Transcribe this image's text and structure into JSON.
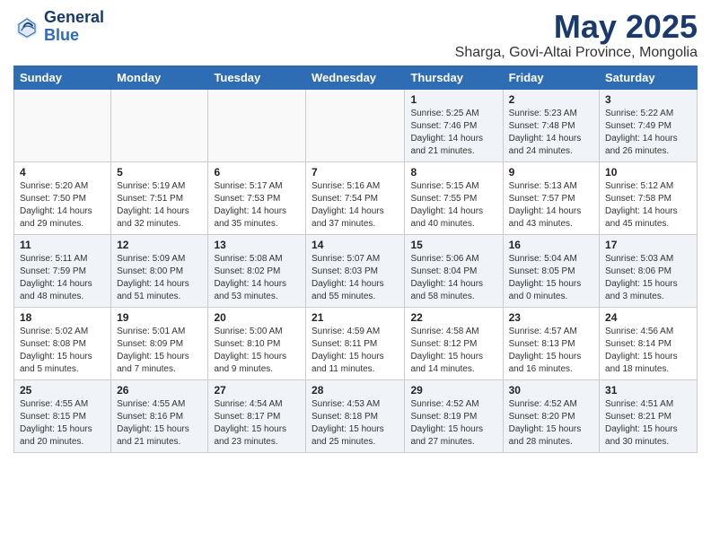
{
  "header": {
    "logo": {
      "line1": "General",
      "line2": "Blue"
    },
    "title": "May 2025",
    "location": "Sharga, Govi-Altai Province, Mongolia"
  },
  "weekdays": [
    "Sunday",
    "Monday",
    "Tuesday",
    "Wednesday",
    "Thursday",
    "Friday",
    "Saturday"
  ],
  "weeks": [
    [
      {
        "day": "",
        "sunrise": "",
        "sunset": "",
        "daylight": ""
      },
      {
        "day": "",
        "sunrise": "",
        "sunset": "",
        "daylight": ""
      },
      {
        "day": "",
        "sunrise": "",
        "sunset": "",
        "daylight": ""
      },
      {
        "day": "",
        "sunrise": "",
        "sunset": "",
        "daylight": ""
      },
      {
        "day": "1",
        "sunrise": "Sunrise: 5:25 AM",
        "sunset": "Sunset: 7:46 PM",
        "daylight": "Daylight: 14 hours and 21 minutes."
      },
      {
        "day": "2",
        "sunrise": "Sunrise: 5:23 AM",
        "sunset": "Sunset: 7:48 PM",
        "daylight": "Daylight: 14 hours and 24 minutes."
      },
      {
        "day": "3",
        "sunrise": "Sunrise: 5:22 AM",
        "sunset": "Sunset: 7:49 PM",
        "daylight": "Daylight: 14 hours and 26 minutes."
      }
    ],
    [
      {
        "day": "4",
        "sunrise": "Sunrise: 5:20 AM",
        "sunset": "Sunset: 7:50 PM",
        "daylight": "Daylight: 14 hours and 29 minutes."
      },
      {
        "day": "5",
        "sunrise": "Sunrise: 5:19 AM",
        "sunset": "Sunset: 7:51 PM",
        "daylight": "Daylight: 14 hours and 32 minutes."
      },
      {
        "day": "6",
        "sunrise": "Sunrise: 5:17 AM",
        "sunset": "Sunset: 7:53 PM",
        "daylight": "Daylight: 14 hours and 35 minutes."
      },
      {
        "day": "7",
        "sunrise": "Sunrise: 5:16 AM",
        "sunset": "Sunset: 7:54 PM",
        "daylight": "Daylight: 14 hours and 37 minutes."
      },
      {
        "day": "8",
        "sunrise": "Sunrise: 5:15 AM",
        "sunset": "Sunset: 7:55 PM",
        "daylight": "Daylight: 14 hours and 40 minutes."
      },
      {
        "day": "9",
        "sunrise": "Sunrise: 5:13 AM",
        "sunset": "Sunset: 7:57 PM",
        "daylight": "Daylight: 14 hours and 43 minutes."
      },
      {
        "day": "10",
        "sunrise": "Sunrise: 5:12 AM",
        "sunset": "Sunset: 7:58 PM",
        "daylight": "Daylight: 14 hours and 45 minutes."
      }
    ],
    [
      {
        "day": "11",
        "sunrise": "Sunrise: 5:11 AM",
        "sunset": "Sunset: 7:59 PM",
        "daylight": "Daylight: 14 hours and 48 minutes."
      },
      {
        "day": "12",
        "sunrise": "Sunrise: 5:09 AM",
        "sunset": "Sunset: 8:00 PM",
        "daylight": "Daylight: 14 hours and 51 minutes."
      },
      {
        "day": "13",
        "sunrise": "Sunrise: 5:08 AM",
        "sunset": "Sunset: 8:02 PM",
        "daylight": "Daylight: 14 hours and 53 minutes."
      },
      {
        "day": "14",
        "sunrise": "Sunrise: 5:07 AM",
        "sunset": "Sunset: 8:03 PM",
        "daylight": "Daylight: 14 hours and 55 minutes."
      },
      {
        "day": "15",
        "sunrise": "Sunrise: 5:06 AM",
        "sunset": "Sunset: 8:04 PM",
        "daylight": "Daylight: 14 hours and 58 minutes."
      },
      {
        "day": "16",
        "sunrise": "Sunrise: 5:04 AM",
        "sunset": "Sunset: 8:05 PM",
        "daylight": "Daylight: 15 hours and 0 minutes."
      },
      {
        "day": "17",
        "sunrise": "Sunrise: 5:03 AM",
        "sunset": "Sunset: 8:06 PM",
        "daylight": "Daylight: 15 hours and 3 minutes."
      }
    ],
    [
      {
        "day": "18",
        "sunrise": "Sunrise: 5:02 AM",
        "sunset": "Sunset: 8:08 PM",
        "daylight": "Daylight: 15 hours and 5 minutes."
      },
      {
        "day": "19",
        "sunrise": "Sunrise: 5:01 AM",
        "sunset": "Sunset: 8:09 PM",
        "daylight": "Daylight: 15 hours and 7 minutes."
      },
      {
        "day": "20",
        "sunrise": "Sunrise: 5:00 AM",
        "sunset": "Sunset: 8:10 PM",
        "daylight": "Daylight: 15 hours and 9 minutes."
      },
      {
        "day": "21",
        "sunrise": "Sunrise: 4:59 AM",
        "sunset": "Sunset: 8:11 PM",
        "daylight": "Daylight: 15 hours and 11 minutes."
      },
      {
        "day": "22",
        "sunrise": "Sunrise: 4:58 AM",
        "sunset": "Sunset: 8:12 PM",
        "daylight": "Daylight: 15 hours and 14 minutes."
      },
      {
        "day": "23",
        "sunrise": "Sunrise: 4:57 AM",
        "sunset": "Sunset: 8:13 PM",
        "daylight": "Daylight: 15 hours and 16 minutes."
      },
      {
        "day": "24",
        "sunrise": "Sunrise: 4:56 AM",
        "sunset": "Sunset: 8:14 PM",
        "daylight": "Daylight: 15 hours and 18 minutes."
      }
    ],
    [
      {
        "day": "25",
        "sunrise": "Sunrise: 4:55 AM",
        "sunset": "Sunset: 8:15 PM",
        "daylight": "Daylight: 15 hours and 20 minutes."
      },
      {
        "day": "26",
        "sunrise": "Sunrise: 4:55 AM",
        "sunset": "Sunset: 8:16 PM",
        "daylight": "Daylight: 15 hours and 21 minutes."
      },
      {
        "day": "27",
        "sunrise": "Sunrise: 4:54 AM",
        "sunset": "Sunset: 8:17 PM",
        "daylight": "Daylight: 15 hours and 23 minutes."
      },
      {
        "day": "28",
        "sunrise": "Sunrise: 4:53 AM",
        "sunset": "Sunset: 8:18 PM",
        "daylight": "Daylight: 15 hours and 25 minutes."
      },
      {
        "day": "29",
        "sunrise": "Sunrise: 4:52 AM",
        "sunset": "Sunset: 8:19 PM",
        "daylight": "Daylight: 15 hours and 27 minutes."
      },
      {
        "day": "30",
        "sunrise": "Sunrise: 4:52 AM",
        "sunset": "Sunset: 8:20 PM",
        "daylight": "Daylight: 15 hours and 28 minutes."
      },
      {
        "day": "31",
        "sunrise": "Sunrise: 4:51 AM",
        "sunset": "Sunset: 8:21 PM",
        "daylight": "Daylight: 15 hours and 30 minutes."
      }
    ]
  ]
}
